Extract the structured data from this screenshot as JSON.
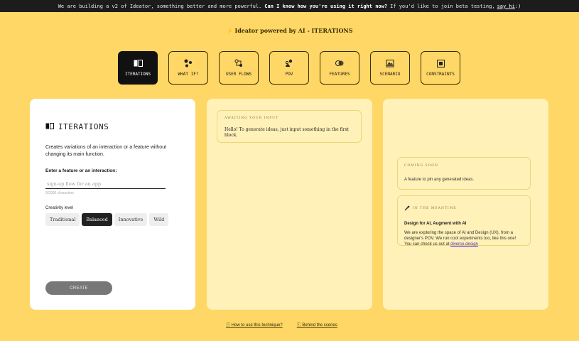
{
  "banner": {
    "prefix": "We are building a v2 of Ideator, something better and more powerful.",
    "question": "Can I know how you're using it right now?",
    "suffix": "If you'd like to join beta testing,",
    "link": "say hi",
    "end": ":)"
  },
  "brand": {
    "title": "Ideator powered by AI - ITERATIONS"
  },
  "tabs": [
    {
      "label": "ITERATIONS",
      "icon": "iterations-icon",
      "active": true
    },
    {
      "label": "WHAT IF?",
      "icon": "what-if-icon"
    },
    {
      "label": "USER FLOWS",
      "icon": "user-flows-icon"
    },
    {
      "label": "POV",
      "icon": "pov-icon"
    },
    {
      "label": "FEATURES",
      "icon": "features-icon"
    },
    {
      "label": "SCENARIO",
      "icon": "scenario-icon"
    },
    {
      "label": "CONSTRAINTS",
      "icon": "constraints-icon"
    }
  ],
  "left": {
    "title": "ITERATIONS",
    "description": "Creates variations of an interaction or a feature without changing its main function.",
    "input_label": "Enter a feature or an interaction:",
    "input_placeholder": "sign-up flow for an app",
    "char_count": "0/2000 characters",
    "creativity_label": "Creativity level",
    "levels": [
      "Traditional",
      "Balanced",
      "Innovative",
      "Wild"
    ],
    "selected_level": "Balanced",
    "create_label": "CREATE"
  },
  "middle": {
    "tag": "AWAITING YOUR INPUT",
    "text": "Hello! To generate ideas, just input something in the first block."
  },
  "right": {
    "soon_tag": "COMING SOON",
    "soon_text": "A feature to pin any generated ideas.",
    "meantime_tag": "IN THE MEANTIME",
    "meantime_title": "Design for AI, Augment with AI",
    "meantime_text": "We are exploring the space of AI and Design (UX), from a designer's POV. We run cool experiments too, like this one! You can check us out at",
    "meantime_link": "diverse.design"
  },
  "footer": {
    "how_to": "ⓘ How to use this technique?",
    "behind": "ⓘ Behind the scenes"
  }
}
